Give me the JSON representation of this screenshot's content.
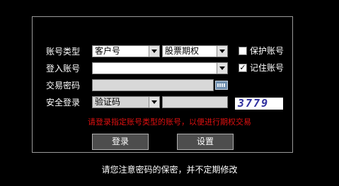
{
  "form": {
    "account_type_label": "账号类型",
    "login_account_label": "登入账号",
    "trade_password_label": "交易密码",
    "security_login_label": "安全登录",
    "account_type_value": "客户号",
    "product_value": "股票期权",
    "login_account_value": "",
    "security_method_value": "验证码",
    "captcha_text": "3779",
    "protect_account_label": "保护账号",
    "protect_account_checked": false,
    "remember_account_label": "记住账号",
    "remember_account_checked": true,
    "checked_glyph": "✓",
    "unchecked_glyph": ""
  },
  "message": "请登录指定账号类型的账号，以便进行期权交易",
  "buttons": {
    "login_label": "登录",
    "settings_label": "设置"
  },
  "footer_note": "请您注意密码的保密，并不定期修改",
  "colors": {
    "background": "#000000",
    "message": "#e01010",
    "panel_border": "#9a9a9a"
  }
}
